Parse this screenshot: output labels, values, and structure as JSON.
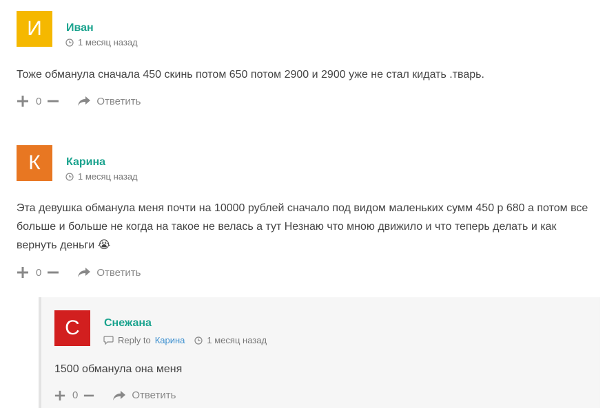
{
  "comments": [
    {
      "initial": "И",
      "avatar_color": "#f5b800",
      "author": "Иван",
      "time": "1 месяц назад",
      "text": "Тоже обманула сначала 450 скинь потом 650 потом 2900 и 2900 уже не стал кидать .тварь.",
      "votes": "0",
      "reply_label": "Ответить"
    },
    {
      "initial": "К",
      "avatar_color": "#e87722",
      "author": "Карина",
      "time": "1 месяц назад",
      "text": "Эта девушка обманула меня почти на 10000 рублей сначало под видом маленьких сумм 450 р 680 а потом все больше и больше не когда на такое не велась а тут Незнаю что мною движило и что теперь делать и как вернуть деньги",
      "emoji": "😭",
      "votes": "0",
      "reply_label": "Ответить"
    }
  ],
  "reply": {
    "initial": "С",
    "avatar_color": "#d21f1f",
    "author": "Снежана",
    "reply_to_label": "Reply to",
    "reply_to_name": "Карина",
    "time": "1 месяц назад",
    "text": "1500 обманула она меня",
    "votes": "0",
    "reply_label": "Ответить"
  },
  "colors": {
    "author": "#1aa38e",
    "link": "#3b8fcf",
    "meta": "#777777"
  }
}
